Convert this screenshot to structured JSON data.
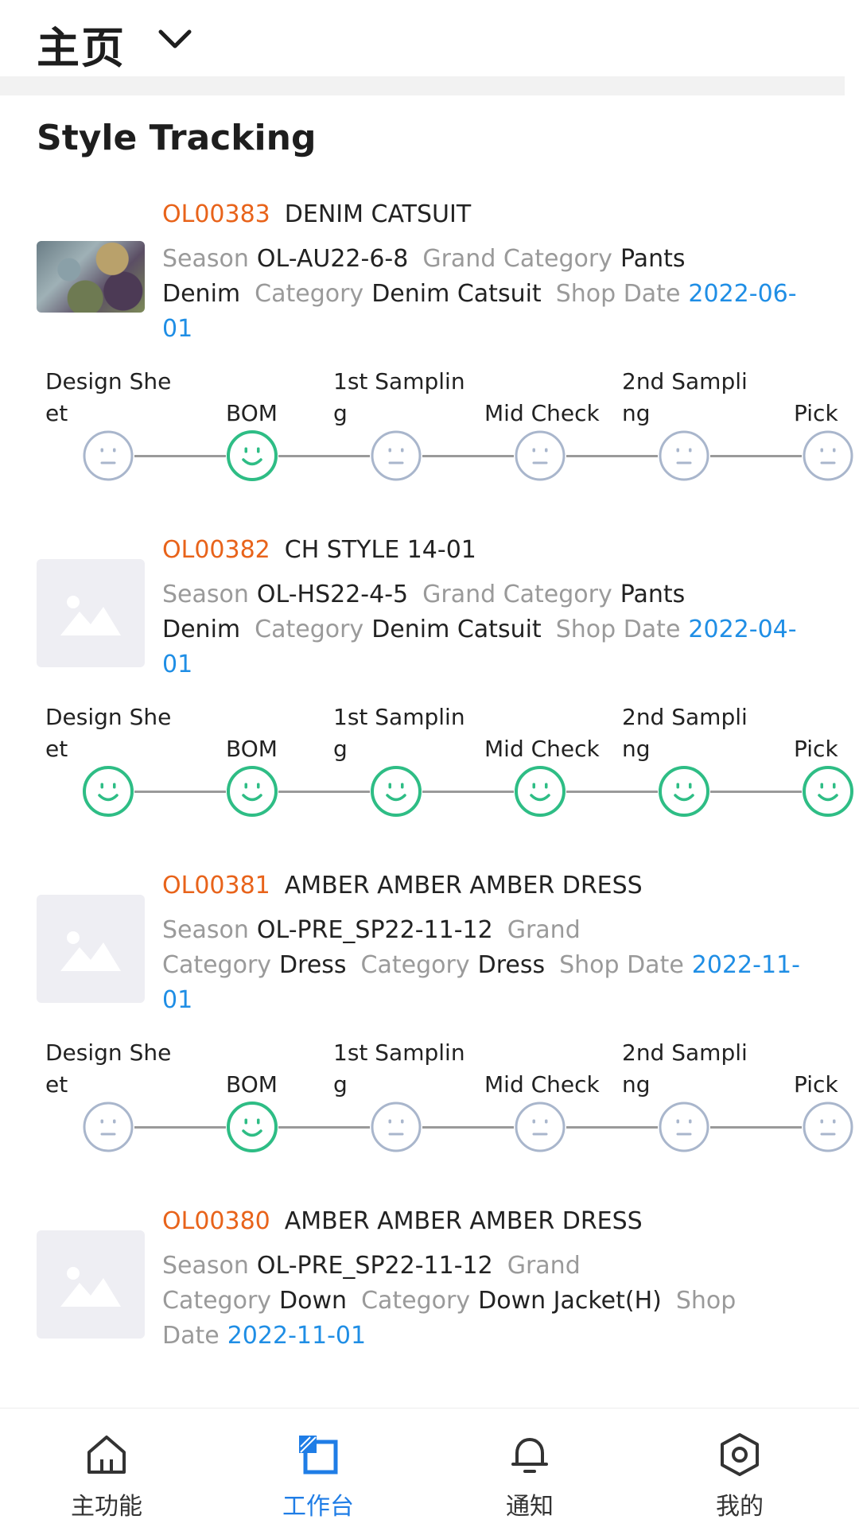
{
  "header": {
    "title": "主页"
  },
  "section": {
    "title": "Style Tracking"
  },
  "labels": {
    "season": "Season",
    "grand_category": "Grand Category",
    "grand_category_a": "Grand",
    "grand_category_b": "Category",
    "category": "Category",
    "shop_date": "Shop Date",
    "shop_date_a": "Shop",
    "shop_date_b": "Date"
  },
  "timeline_labels": {
    "design_sheet_1": "Design She",
    "design_sheet_2": "et",
    "bom": "BOM",
    "first_sampling_1": "1st Samplin",
    "first_sampling_2": "g",
    "mid_check": "Mid Check",
    "second_sampling_1": "2nd Sampli",
    "second_sampling_2": "ng",
    "pick": "Pick"
  },
  "styles": [
    {
      "code": "OL00383",
      "name": "DENIM CATSUIT",
      "season": "OL-AU22-6-8",
      "grand_category_1": "Pants",
      "grand_category_2": "Denim",
      "category": "Denim Catsuit",
      "shop_date_1": "2022-06-",
      "shop_date_2": "01",
      "has_photo": true,
      "stages": [
        "neutral",
        "happy",
        "neutral",
        "neutral",
        "neutral",
        "neutral"
      ]
    },
    {
      "code": "OL00382",
      "name": "CH STYLE 14-01",
      "season": "OL-HS22-4-5",
      "grand_category_1": "Pants",
      "grand_category_2": "Denim",
      "category": "Denim Catsuit",
      "shop_date_1": "2022-04-",
      "shop_date_2": "01",
      "has_photo": false,
      "stages": [
        "happy",
        "happy",
        "happy",
        "happy",
        "happy",
        "happy"
      ]
    },
    {
      "code": "OL00381",
      "name": "AMBER AMBER AMBER DRESS",
      "season": "OL-PRE_SP22-11-12",
      "grand_category": "Dress",
      "category": "Dress",
      "shop_date_1": "2022-11-",
      "shop_date_2": "01",
      "has_photo": false,
      "stages": [
        "neutral",
        "happy",
        "neutral",
        "neutral",
        "neutral",
        "neutral"
      ]
    },
    {
      "code": "OL00380",
      "name": "AMBER AMBER AMBER DRESS",
      "season": "OL-PRE_SP22-11-12",
      "grand_category": "Down",
      "category": "Down Jacket(H)",
      "shop_date": "2022-11-01",
      "has_photo": false
    }
  ],
  "colors": {
    "accent": "#1f7de6",
    "code": "#e8631a",
    "date": "#1f8ee5",
    "happy": "#2ebd85",
    "neutral": "#a9b6cc"
  },
  "bottom_nav": [
    {
      "label": "主功能",
      "icon": "home-icon",
      "active": false
    },
    {
      "label": "工作台",
      "icon": "workbench-icon",
      "active": true
    },
    {
      "label": "通知",
      "icon": "bell-icon",
      "active": false
    },
    {
      "label": "我的",
      "icon": "profile-hexagon-icon",
      "active": false
    }
  ]
}
